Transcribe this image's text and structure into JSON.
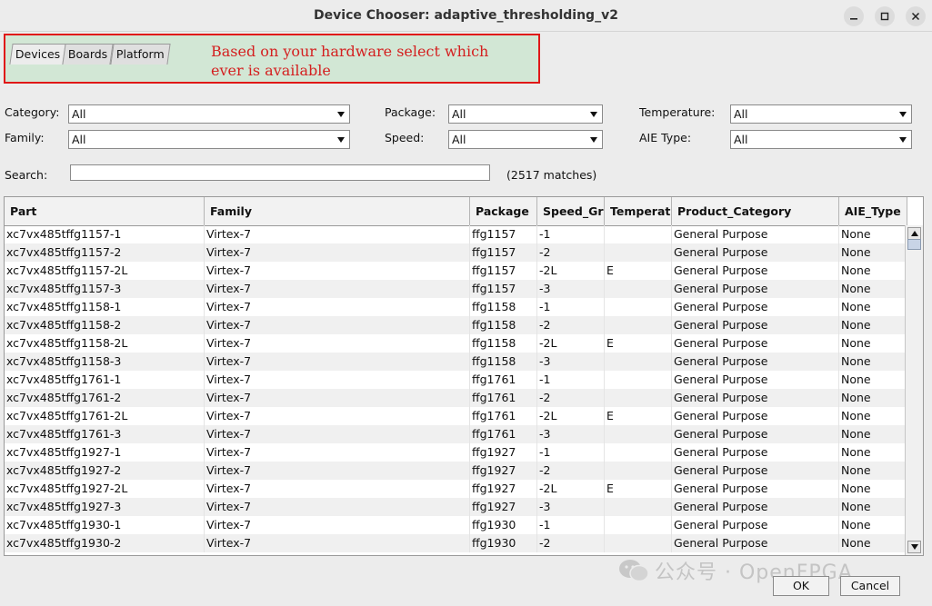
{
  "window": {
    "title": "Device Chooser: adaptive_thresholding_v2"
  },
  "tabs": [
    {
      "label": "Devices"
    },
    {
      "label": "Boards"
    },
    {
      "label": "Platform"
    }
  ],
  "annotation": {
    "text": "Based on your hardware select which ever is available",
    "border_color": "#e01818",
    "background_color": "#d2e7d5",
    "text_color": "#d42020"
  },
  "filters": {
    "category": {
      "label": "Category:",
      "value": "All"
    },
    "family": {
      "label": "Family:",
      "value": "All"
    },
    "package": {
      "label": "Package:",
      "value": "All"
    },
    "speed": {
      "label": "Speed:",
      "value": "All"
    },
    "temperature": {
      "label": "Temperature:",
      "value": "All"
    },
    "aie_type": {
      "label": "AIE Type:",
      "value": "All"
    }
  },
  "search": {
    "label": "Search:",
    "value": "",
    "matches": "(2517 matches)"
  },
  "table": {
    "columns": [
      "Part",
      "Family",
      "Package",
      "Speed_Grade",
      "Temperature",
      "Product_Category",
      "AIE_Type"
    ],
    "rows": [
      [
        "xc7vx485tffg1157-1",
        "Virtex-7",
        "ffg1157",
        "-1",
        "",
        "General Purpose",
        "None"
      ],
      [
        "xc7vx485tffg1157-2",
        "Virtex-7",
        "ffg1157",
        "-2",
        "",
        "General Purpose",
        "None"
      ],
      [
        "xc7vx485tffg1157-2L",
        "Virtex-7",
        "ffg1157",
        "-2L",
        "E",
        "General Purpose",
        "None"
      ],
      [
        "xc7vx485tffg1157-3",
        "Virtex-7",
        "ffg1157",
        "-3",
        "",
        "General Purpose",
        "None"
      ],
      [
        "xc7vx485tffg1158-1",
        "Virtex-7",
        "ffg1158",
        "-1",
        "",
        "General Purpose",
        "None"
      ],
      [
        "xc7vx485tffg1158-2",
        "Virtex-7",
        "ffg1158",
        "-2",
        "",
        "General Purpose",
        "None"
      ],
      [
        "xc7vx485tffg1158-2L",
        "Virtex-7",
        "ffg1158",
        "-2L",
        "E",
        "General Purpose",
        "None"
      ],
      [
        "xc7vx485tffg1158-3",
        "Virtex-7",
        "ffg1158",
        "-3",
        "",
        "General Purpose",
        "None"
      ],
      [
        "xc7vx485tffg1761-1",
        "Virtex-7",
        "ffg1761",
        "-1",
        "",
        "General Purpose",
        "None"
      ],
      [
        "xc7vx485tffg1761-2",
        "Virtex-7",
        "ffg1761",
        "-2",
        "",
        "General Purpose",
        "None"
      ],
      [
        "xc7vx485tffg1761-2L",
        "Virtex-7",
        "ffg1761",
        "-2L",
        "E",
        "General Purpose",
        "None"
      ],
      [
        "xc7vx485tffg1761-3",
        "Virtex-7",
        "ffg1761",
        "-3",
        "",
        "General Purpose",
        "None"
      ],
      [
        "xc7vx485tffg1927-1",
        "Virtex-7",
        "ffg1927",
        "-1",
        "",
        "General Purpose",
        "None"
      ],
      [
        "xc7vx485tffg1927-2",
        "Virtex-7",
        "ffg1927",
        "-2",
        "",
        "General Purpose",
        "None"
      ],
      [
        "xc7vx485tffg1927-2L",
        "Virtex-7",
        "ffg1927",
        "-2L",
        "E",
        "General Purpose",
        "None"
      ],
      [
        "xc7vx485tffg1927-3",
        "Virtex-7",
        "ffg1927",
        "-3",
        "",
        "General Purpose",
        "None"
      ],
      [
        "xc7vx485tffg1930-1",
        "Virtex-7",
        "ffg1930",
        "-1",
        "",
        "General Purpose",
        "None"
      ],
      [
        "xc7vx485tffg1930-2",
        "Virtex-7",
        "ffg1930",
        "-2",
        "",
        "General Purpose",
        "None"
      ]
    ]
  },
  "buttons": {
    "ok": "OK",
    "cancel": "Cancel"
  },
  "watermark": "公众号 · OpenFPGA"
}
